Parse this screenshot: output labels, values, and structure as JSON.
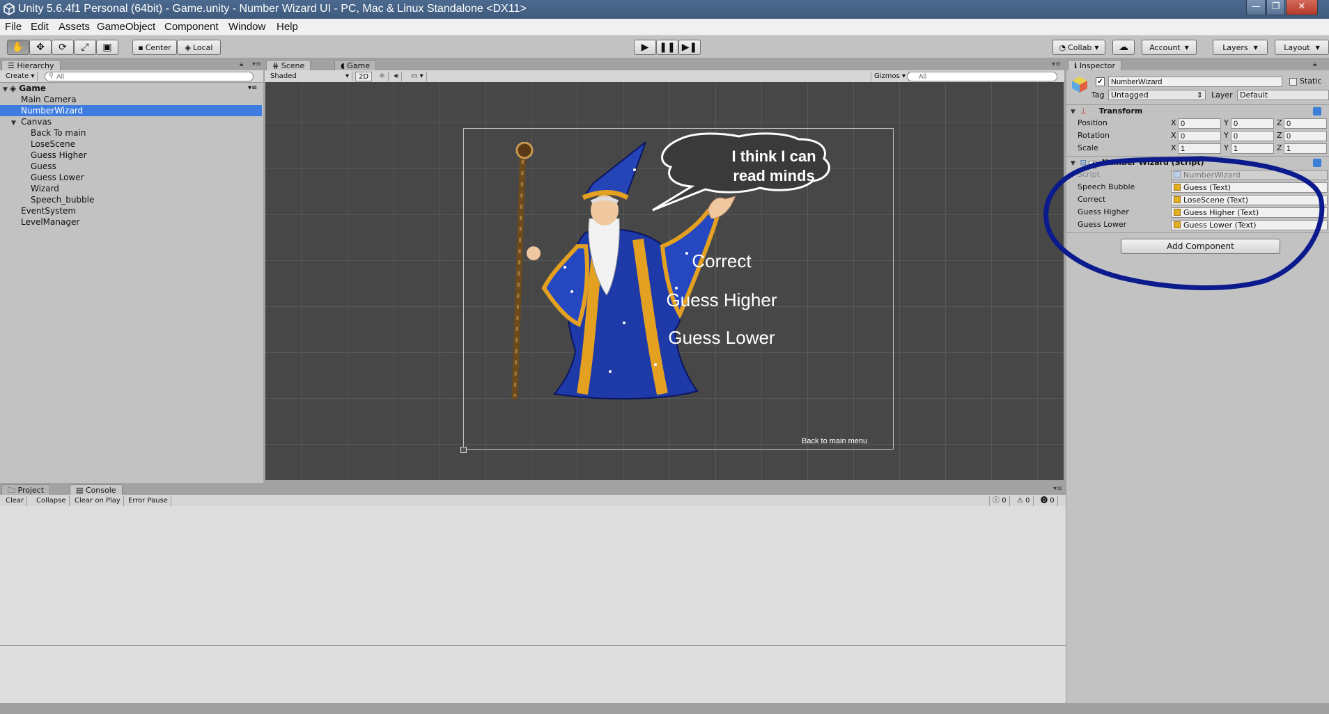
{
  "window": {
    "title": "Unity 5.6.4f1 Personal (64bit) - Game.unity - Number Wizard UI - PC, Mac & Linux Standalone <DX11>",
    "minimize": "—",
    "maximize": "❐",
    "close": "✕"
  },
  "menu": [
    "File",
    "Edit",
    "Assets",
    "GameObject",
    "Component",
    "Window",
    "Help"
  ],
  "toolbar": {
    "pivot": "Center",
    "space": "Local",
    "collab": "Collab",
    "account": "Account",
    "layers": "Layers",
    "layout": "Layout"
  },
  "hierarchy": {
    "tab": "Hierarchy",
    "create": "Create",
    "search_placeholder": "All",
    "scene": "Game",
    "items": [
      "Main Camera",
      "NumberWizard",
      "Canvas",
      "Back To main",
      "LoseScene",
      "Guess Higher",
      "Guess",
      "Guess Lower",
      "Wizard",
      "Speech_bubble",
      "EventSystem",
      "LevelManager"
    ],
    "selected": "NumberWizard"
  },
  "scene": {
    "tabs": [
      "Scene",
      "Game"
    ],
    "shading": "Shaded",
    "mode2d": "2D",
    "gizmos": "Gizmos",
    "search_placeholder": "All"
  },
  "game_ui": {
    "speech_line1": "I think I can",
    "speech_line2": "read minds",
    "correct": "Correct",
    "guess_higher": "Guess Higher",
    "guess_lower": "Guess Lower",
    "back": "Back to main menu"
  },
  "inspector": {
    "tab": "Inspector",
    "object_name": "NumberWizard",
    "static_label": "Static",
    "tag_label": "Tag",
    "tag_value": "Untagged",
    "layer_label": "Layer",
    "layer_value": "Default",
    "transform": {
      "header": "Transform",
      "position_label": "Position",
      "rotation_label": "Rotation",
      "scale_label": "Scale",
      "position": [
        "0",
        "0",
        "0"
      ],
      "rotation": [
        "0",
        "0",
        "0"
      ],
      "scale": [
        "1",
        "1",
        "1"
      ]
    },
    "script_component": {
      "header": "Number Wizard (Script)",
      "script_label": "Script",
      "script_value": "NumberWizard",
      "fields": [
        {
          "label": "Speech Bubble",
          "value": "Guess (Text)"
        },
        {
          "label": "Correct",
          "value": "LoseScene (Text)"
        },
        {
          "label": "Guess Higher",
          "value": "Guess Higher (Text)"
        },
        {
          "label": "Guess Lower",
          "value": "Guess Lower (Text)"
        }
      ]
    },
    "add_component": "Add Component"
  },
  "console": {
    "tabs": [
      "Project",
      "Console"
    ],
    "buttons": [
      "Clear",
      "Collapse",
      "Clear on Play",
      "Error Pause"
    ],
    "counts": {
      "info": "0",
      "warning": "0",
      "error": "0"
    }
  },
  "colors": {
    "selection": "#3e7ce0",
    "annotation": "#0b1a8c",
    "scene_bg": "#474747"
  }
}
